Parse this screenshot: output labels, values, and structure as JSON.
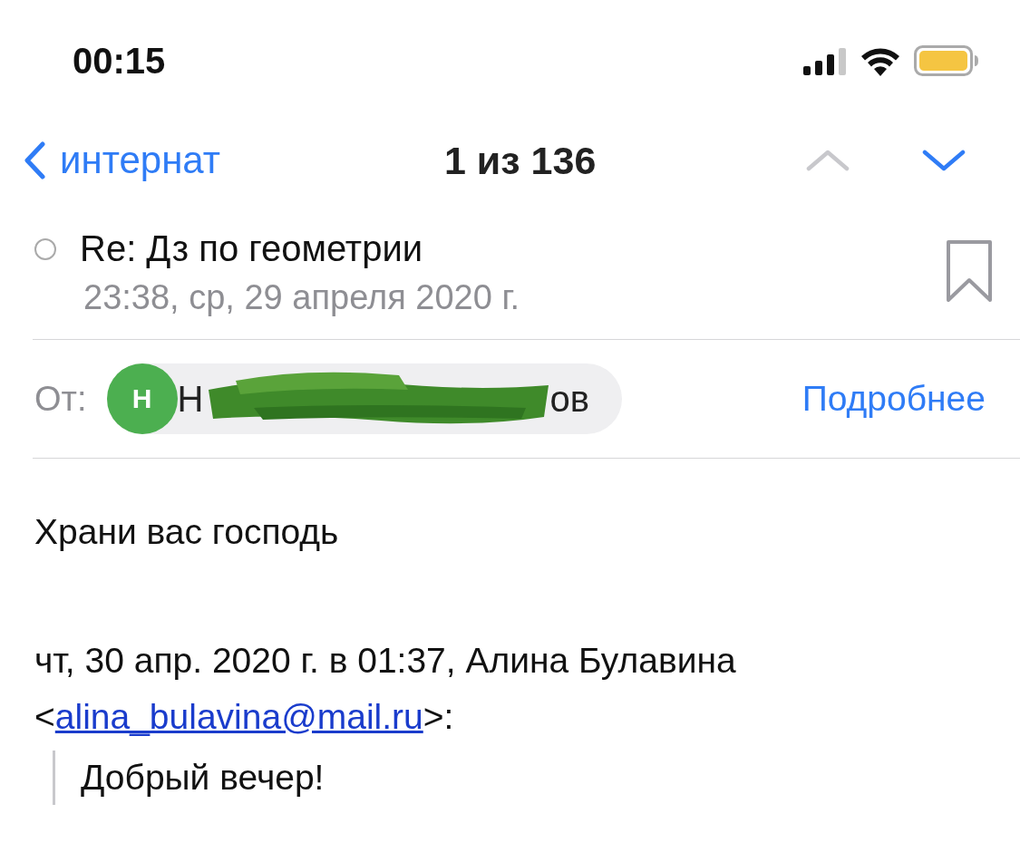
{
  "status_bar": {
    "time": "00:15"
  },
  "nav": {
    "back_label": "интернат",
    "position": "1 из 136",
    "prev_enabled": false,
    "next_enabled": true
  },
  "message": {
    "unread": false,
    "flagged": false,
    "subject": "Re: Дз по геометрии",
    "date": "23:38, ср, 29 апреля 2020 г.",
    "from_label": "От:",
    "sender_initial": "Н",
    "sender_name_start": "Н",
    "sender_name_end": "ов",
    "sender_redacted": true,
    "details_link": "Подробнее",
    "body": [
      {
        "kind": "paragraph",
        "text": "Храни вас господь"
      },
      {
        "kind": "attribution",
        "text": "чт, 30 апр. 2020 г. в 01:37, Алина Булавина",
        "open": "<",
        "email": "alina_bulavina@mail.ru",
        "close": ">:"
      },
      {
        "kind": "quote",
        "text": "Добрый вечер!"
      }
    ]
  }
}
